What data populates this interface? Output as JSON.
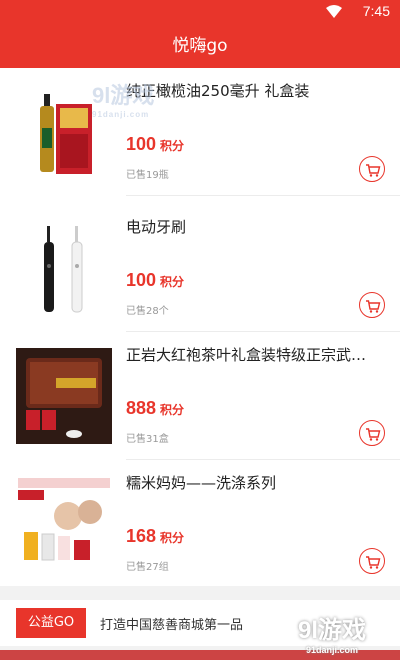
{
  "status_bar": {
    "time": "7:45"
  },
  "app_bar": {
    "title": "悦嗨go"
  },
  "products": [
    {
      "name": "纯正橄榄油250毫升 礼盒装",
      "price": "100",
      "unit": "积分",
      "sold": "已售19瓶"
    },
    {
      "name": "电动牙刷",
      "price": "100",
      "unit": "积分",
      "sold": "已售28个"
    },
    {
      "name": "正岩大红袍茶叶礼盒装特级正宗武…",
      "price": "888",
      "unit": "积分",
      "sold": "已售31盒"
    },
    {
      "name": "糯米妈妈——洗涤系列",
      "price": "168",
      "unit": "积分",
      "sold": "已售27组"
    }
  ],
  "banner": {
    "tag": "公益GO",
    "slogan": "打造中国慈善商城第一品"
  },
  "watermark": {
    "brand": "9l游戏",
    "site": "91danji.com"
  },
  "colors": {
    "accent": "#e8352b"
  }
}
